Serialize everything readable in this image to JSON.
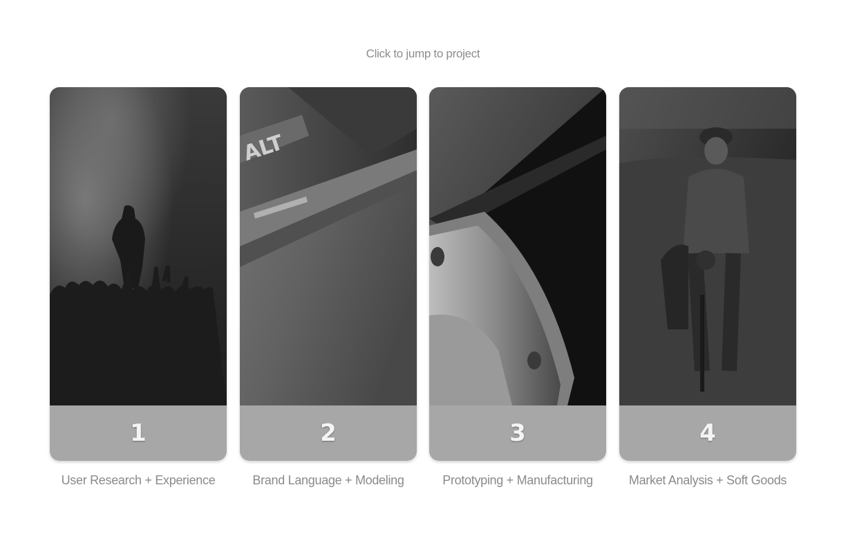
{
  "header": {
    "hint": "Click to jump to project"
  },
  "projects": [
    {
      "number": "1",
      "caption": "User Research + Experience",
      "image": "concert-crowd-photo"
    },
    {
      "number": "2",
      "caption": "Brand Language + Modeling",
      "image": "toolbox-closeup-photo"
    },
    {
      "number": "3",
      "caption": "Prototyping + Manufacturing",
      "image": "machined-part-photo"
    },
    {
      "number": "4",
      "caption": "Market Analysis + Soft Goods",
      "image": "cyclist-photo"
    }
  ],
  "photo_texts": {
    "toolbox_logo": "ALT"
  }
}
